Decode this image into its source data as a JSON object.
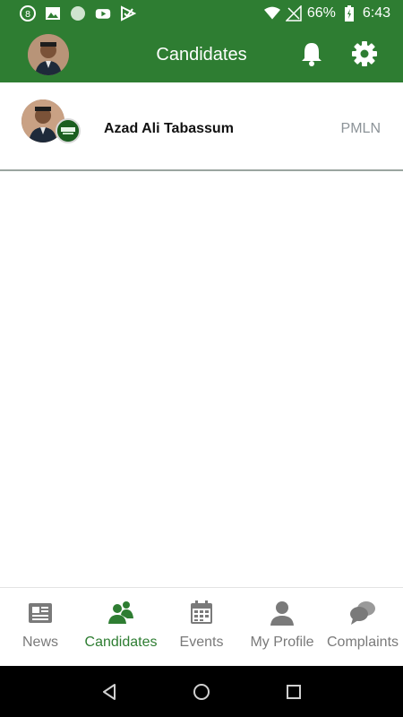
{
  "status_bar": {
    "battery_percent": "66%",
    "time": "6:43",
    "icons": [
      "notification-icon",
      "image-icon",
      "circle-icon",
      "youtube-icon",
      "check-icon",
      "wifi-icon",
      "no-signal-icon",
      "battery-icon"
    ]
  },
  "app_bar": {
    "title": "Candidates",
    "icons": [
      "bell-icon",
      "gear-icon"
    ]
  },
  "candidates": [
    {
      "name": "Azad Ali Tabassum",
      "party": "PMLN"
    }
  ],
  "bottom_nav": {
    "items": [
      {
        "label": "News",
        "icon": "newspaper-icon"
      },
      {
        "label": "Candidates",
        "icon": "candidates-icon"
      },
      {
        "label": "Events",
        "icon": "calendar-icon"
      },
      {
        "label": "My Profile",
        "icon": "person-icon"
      },
      {
        "label": "Complaints",
        "icon": "chat-bubbles-icon"
      }
    ],
    "active": "Candidates"
  },
  "colors": {
    "primary": "#2e7d32",
    "active_nav": "#2e7d32",
    "inactive_nav": "#7a7a7a",
    "party_text": "#8c9398"
  }
}
